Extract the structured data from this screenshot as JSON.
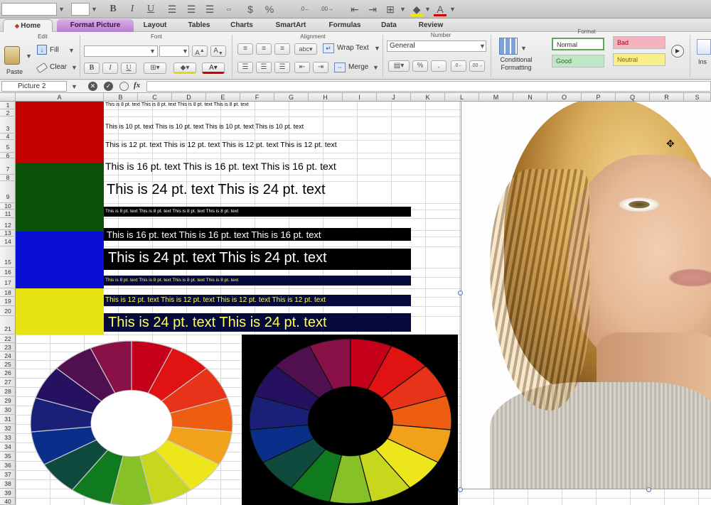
{
  "toolbar": {
    "bold": "B",
    "italic": "I",
    "underline": "U",
    "currency": "$",
    "percent": "%",
    "text_color_letter": "A"
  },
  "tabs": [
    "Home",
    "Format Picture",
    "Layout",
    "Tables",
    "Charts",
    "SmartArt",
    "Formulas",
    "Data",
    "Review"
  ],
  "ribbon": {
    "groups": [
      "Edit",
      "Font",
      "Alignment",
      "Number",
      "Format"
    ],
    "paste": "Paste",
    "fill": "Fill",
    "clear": "Clear",
    "bold": "B",
    "italic": "I",
    "underline": "U",
    "grow_font": "A",
    "shrink_font": "A",
    "abc_label": "abc",
    "wrap_text": "Wrap Text",
    "merge": "Merge",
    "number_format": "General",
    "percent": "%",
    "conditional_formatting": "Conditional Formatting",
    "styles": {
      "normal": "Normal",
      "bad": "Bad",
      "good": "Good",
      "neutral": "Neutral"
    },
    "insert_cut": "Ins"
  },
  "formula_bar": {
    "name_box": "Picture 2",
    "fx": "fx"
  },
  "columns": [
    "A",
    "B",
    "C",
    "D",
    "E",
    "F",
    "G",
    "H",
    "I",
    "J",
    "K",
    "L",
    "M",
    "N",
    "O",
    "P",
    "Q",
    "R",
    "S"
  ],
  "rows": [
    "1",
    "2",
    "3",
    "4",
    "5",
    "6",
    "7",
    "8",
    "9",
    "10",
    "11",
    "12",
    "13",
    "14",
    "15",
    "16",
    "17",
    "18",
    "19",
    "20",
    "21",
    "22",
    "23",
    "24",
    "25",
    "26",
    "27",
    "28",
    "29",
    "30",
    "31",
    "32",
    "33",
    "34",
    "35",
    "36",
    "37",
    "38",
    "39",
    "40"
  ],
  "swatches": {
    "red": "#c40000",
    "green": "#0a520a",
    "blue": "#0a0fd6",
    "yellow": "#e8e414"
  },
  "text_rows": [
    {
      "text": "This is 8 pt. text  This is 8 pt. text  This is 8 pt. text  This is 8 pt. text",
      "color": "#000"
    },
    {
      "text": "This is 10 pt. text  This is 10 pt. text  This is 10 pt. text  This is 10 pt. text",
      "color": "#000"
    },
    {
      "text": "This is 12 pt. text  This is 12 pt. text  This is 12 pt. text  This is 12 pt. text",
      "color": "#000"
    },
    {
      "text": "This is 16 pt. text   This is 16 pt. text   This is 16 pt. text",
      "color": "#000"
    },
    {
      "text": "This is 24 pt. text   This is 24 pt. text",
      "color": "#000"
    },
    {
      "text": "This is 8 pt. text  This is 8 pt. text  This is 8 pt. text  This is 8 pt. text",
      "color": "#fff"
    },
    {
      "text": "This is 16 pt. text   This is 16 pt. text   This is 16 pt. text",
      "color": "#fff"
    },
    {
      "text": "This is 24 pt. text   This is 24 pt. text",
      "color": "#fff"
    },
    {
      "text": "This is 8 pt. text  This is 8 pt. text  This is 8 pt. text  This is 8 pt. text",
      "color": "#ffff55"
    },
    {
      "text": "This is 12 pt. text   This is 12 pt. text   This is 12 pt. text   This is 12 pt. text",
      "color": "#ffff55"
    },
    {
      "text": "This is 24 pt. text   This is 24 pt. text",
      "color": "#ffff55"
    }
  ],
  "wheel_colors": [
    "#c5001a",
    "#e01212",
    "#e8321a",
    "#ee5e12",
    "#f1a21a",
    "#ede61a",
    "#c7d71e",
    "#87c128",
    "#107a1e",
    "#0e4a3e",
    "#0a2f8a",
    "#1a1f78",
    "#261060",
    "#501050",
    "#8a1048"
  ]
}
